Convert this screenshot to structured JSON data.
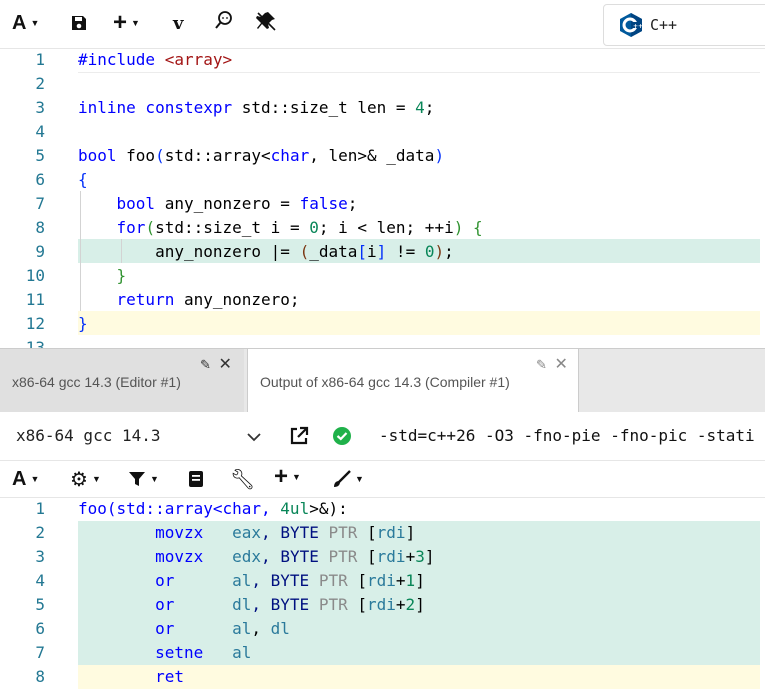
{
  "toolbar": {
    "font_btn": "A",
    "save_icon": "save-icon",
    "add_btn": "+",
    "vim_btn": "v",
    "search_icon": "search-icon",
    "pin_icon": "pin-icon",
    "language": "C++"
  },
  "source": {
    "lines": [
      {
        "n": "1"
      },
      {
        "n": "2"
      },
      {
        "n": "3"
      },
      {
        "n": "4"
      },
      {
        "n": "5"
      },
      {
        "n": "6"
      },
      {
        "n": "7"
      },
      {
        "n": "8"
      },
      {
        "n": "9"
      },
      {
        "n": "10"
      },
      {
        "n": "11"
      },
      {
        "n": "12"
      },
      {
        "n": "13"
      }
    ],
    "tokens": {
      "l1_a": "#include ",
      "l1_b": "<array>",
      "l3_a": "inline constexpr",
      "l3_b": " std::size_t len = ",
      "l3_c": "4",
      "l3_d": ";",
      "l5_a": "bool",
      "l5_b": " foo",
      "l5_c": "(",
      "l5_d": "std::array<",
      "l5_e": "char",
      "l5_f": ", len>& _data",
      "l5_g": ")",
      "l6_a": "{",
      "l7_a": "bool",
      "l7_b": " any_nonzero = ",
      "l7_c": "false",
      "l7_d": ";",
      "l8_a": "for",
      "l8_b": "(",
      "l8_c": "std::size_t i = ",
      "l8_d": "0",
      "l8_e": "; i < len; ++i",
      "l8_f": ")",
      "l8_g": " {",
      "l9_a": "any_nonzero |= ",
      "l9_b": "(",
      "l9_c": "_data",
      "l9_d": "[",
      "l9_e": "i",
      "l9_f": "]",
      "l9_g": " != ",
      "l9_h": "0",
      "l9_i": ")",
      "l9_j": ";",
      "l10_a": "}",
      "l11_a": "return",
      "l11_b": " any_nonzero;",
      "l12_a": "}"
    }
  },
  "tabs": [
    {
      "label": "x86-64 gcc 14.3 (Editor #1)"
    },
    {
      "label": "Output of x86-64 gcc 14.3 (Compiler #1)"
    }
  ],
  "compiler": {
    "name": "x86-64 gcc 14.3",
    "options": "-std=c++26 -O3 -fno-pie -fno-pic -stati",
    "toolbar_font": "A"
  },
  "asm": {
    "lines": [
      {
        "n": "1"
      },
      {
        "n": "2"
      },
      {
        "n": "3"
      },
      {
        "n": "4"
      },
      {
        "n": "5"
      },
      {
        "n": "6"
      },
      {
        "n": "7"
      },
      {
        "n": "8"
      }
    ],
    "tokens": {
      "a1_a": "foo(std::array<",
      "a1_b": "char",
      "a1_c": ", ",
      "a1_d": "4ul",
      "a1_e": ">&):",
      "a2_op": "movzx",
      "a2_r": "eax",
      "a2_m": ", BYTE ",
      "a2_p": "PTR",
      "a2_b": " [",
      "a2_x": "rdi",
      "a2_e": "]",
      "a3_op": "movzx",
      "a3_r": "edx",
      "a3_m": ", BYTE ",
      "a3_p": "PTR",
      "a3_b": " [",
      "a3_x": "rdi",
      "a3_plus": "+",
      "a3_n": "3",
      "a3_e": "]",
      "a4_op": "or",
      "a4_r": "al",
      "a4_m": ", BYTE ",
      "a4_p": "PTR",
      "a4_b": " [",
      "a4_x": "rdi",
      "a4_plus": "+",
      "a4_n": "1",
      "a4_e": "]",
      "a5_op": "or",
      "a5_r": "dl",
      "a5_m": ", BYTE ",
      "a5_p": "PTR",
      "a5_b": " [",
      "a5_x": "rdi",
      "a5_plus": "+",
      "a5_n": "2",
      "a5_e": "]",
      "a6_op": "or",
      "a6_r": "al",
      "a6_m": ", ",
      "a6_r2": "dl",
      "a7_op": "setne",
      "a7_r": "al",
      "a8_op": "ret"
    }
  },
  "colors": {
    "highlight_green": "#d8efe8",
    "highlight_yellow": "#fffbe0",
    "success_green": "#1fb14a"
  }
}
